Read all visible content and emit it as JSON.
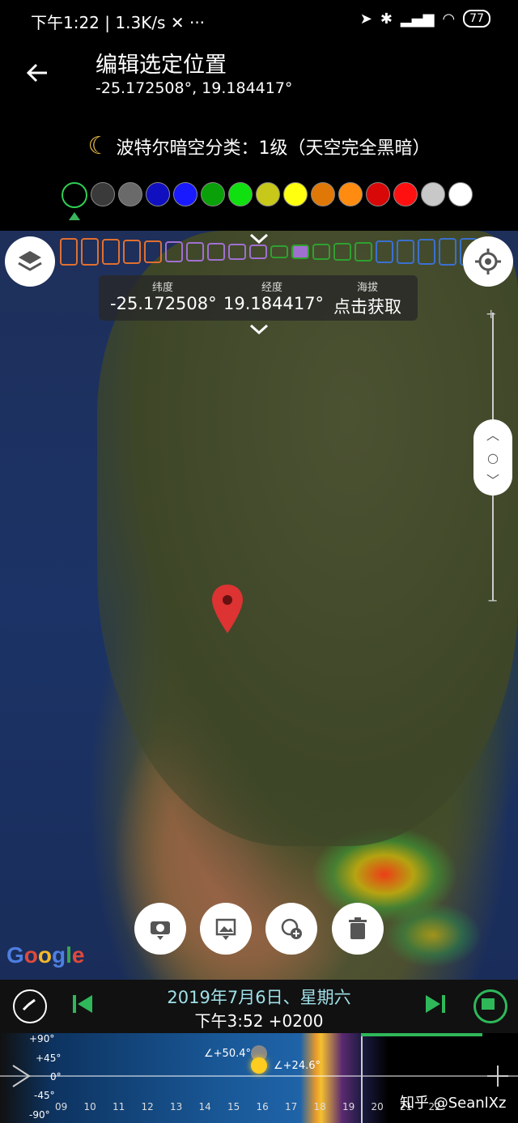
{
  "status": {
    "time": "下午1:22",
    "speed": "1.3K/s",
    "battery": "77"
  },
  "header": {
    "title": "编辑选定位置",
    "coords": "-25.172508°, 19.184417°"
  },
  "bortle": {
    "label": "波特尔暗空分类：1级（天空完全黑暗）",
    "colors": [
      "#000000",
      "#3a3a3a",
      "#6a6a6a",
      "#1010c0",
      "#1a1aff",
      "#0aa00a",
      "#10e010",
      "#c8c81a",
      "#ffff10",
      "#e07808",
      "#ff8c10",
      "#d80808",
      "#ff1010",
      "#c8c8c8",
      "#ffffff"
    ]
  },
  "info": {
    "lat_label": "纬度",
    "lat": "-25.172508°",
    "lon_label": "经度",
    "lon": "19.184417°",
    "alt_label": "海拔",
    "alt": "点击获取"
  },
  "map": {
    "logo": "Google"
  },
  "zoom": {
    "plus": "+",
    "minus": "−"
  },
  "bottom": {
    "date": "2019年7月6日、星期六",
    "time": "下午3:52 +0200"
  },
  "timeline": {
    "hours": [
      "09",
      "10",
      "11",
      "12",
      "13",
      "14",
      "15",
      "16",
      "17",
      "18",
      "19",
      "20",
      "21",
      "22"
    ],
    "moon_alt": "∠+50.4°",
    "sun_alt": "∠+24.6°",
    "alt_ticks": [
      "+90°",
      "+45°",
      "0°",
      "-45°",
      "-90°"
    ]
  },
  "watermark": "知乎 @SeanlXz"
}
